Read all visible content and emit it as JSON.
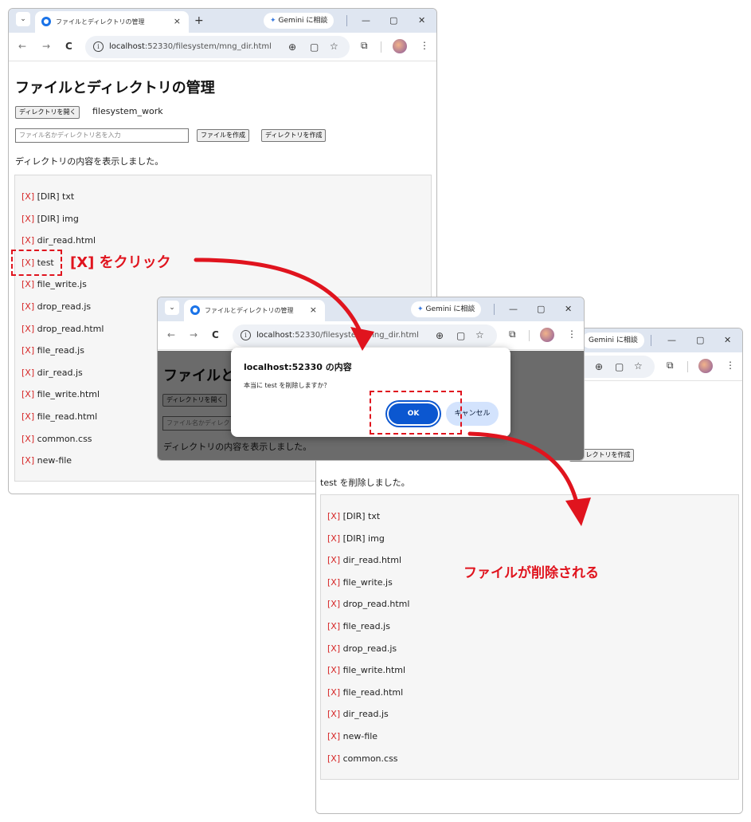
{
  "browser": {
    "tab_selector": "⌄",
    "tab_title": "ファイルとディレクトリの管理",
    "tab_close": "×",
    "new_tab": "+",
    "gemini_label": "Gemini に相談",
    "minimize": "—",
    "maximize": "▢",
    "close": "✕",
    "back": "←",
    "forward": "→",
    "reload": "C",
    "info": "i",
    "url_host": "localhost",
    "url_path": ":52330/filesystem/mng_dir.html",
    "zoom": "⊕",
    "page": "▢",
    "star": "☆",
    "ext": "⧉",
    "menu": "⋮"
  },
  "page": {
    "title": "ファイルとディレクトリの管理",
    "open_dir_button": "ディレクトリを開く",
    "dir_name": "filesystem_work",
    "name_input_placeholder": "ファイル名かディレクトリ名を入力",
    "create_file_button": "ファイルを作成",
    "create_dir_button": "ディレクトリを作成",
    "status_before": "ディレクトリの内容を表示しました。",
    "status_after": "test を削除しました。",
    "delete_marker": "[X]"
  },
  "list_before": [
    "[DIR] txt",
    "[DIR] img",
    "dir_read.html",
    "test",
    "file_write.js",
    "drop_read.js",
    "drop_read.html",
    "file_read.js",
    "dir_read.js",
    "file_write.html",
    "file_read.html",
    "common.css",
    "new-file"
  ],
  "list_after": [
    "[DIR] txt",
    "[DIR] img",
    "dir_read.html",
    "file_write.js",
    "drop_read.html",
    "file_read.js",
    "drop_read.js",
    "file_write.html",
    "file_read.html",
    "dir_read.js",
    "new-file",
    "common.css"
  ],
  "dialog": {
    "title": "localhost:52330 の内容",
    "message": "本当に test を削除しますか？",
    "ok": "OK",
    "cancel": "キャンセル"
  },
  "annotations": {
    "click_label": "[X] をクリック",
    "result_label": "ファイルが削除される"
  },
  "colors": {
    "annotation_red": "#e0141e",
    "delete_marker": "#d62828",
    "ok_button": "#0b57d0",
    "cancel_button": "#d3e3fd",
    "tabstrip": "#dfe6f1"
  }
}
